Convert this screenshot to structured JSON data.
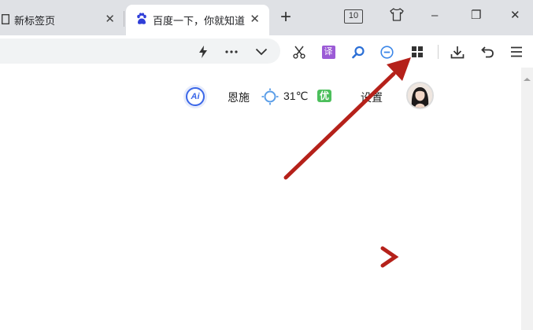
{
  "tabs": [
    {
      "title": "新标签页",
      "close": "✕"
    },
    {
      "title": "百度一下，你就知道",
      "close": "✕"
    }
  ],
  "new_tab_label": "+",
  "tab_count": "10",
  "window_controls": {
    "minimize": "–",
    "maximize": "❐",
    "close": "✕"
  },
  "toolbar": {
    "icons": [
      "lightning-icon",
      "more-icon",
      "chevron-down-icon",
      "scissors-icon",
      "translate-icon",
      "search-icon",
      "zoom-out-icon",
      "apps-icon",
      "download-icon",
      "undo-icon",
      "menu-icon"
    ],
    "translate_label": "译"
  },
  "newtab_page": {
    "ai_label": "Ai",
    "city": "恩施",
    "temperature": "31℃",
    "aqi": "优",
    "settings_label": "设置"
  },
  "colors": {
    "accent_blue": "#3b67e8",
    "aqi_green": "#4cbf5c",
    "annotation_red": "#b5211a",
    "translate_purple": "#9c5bd6"
  }
}
